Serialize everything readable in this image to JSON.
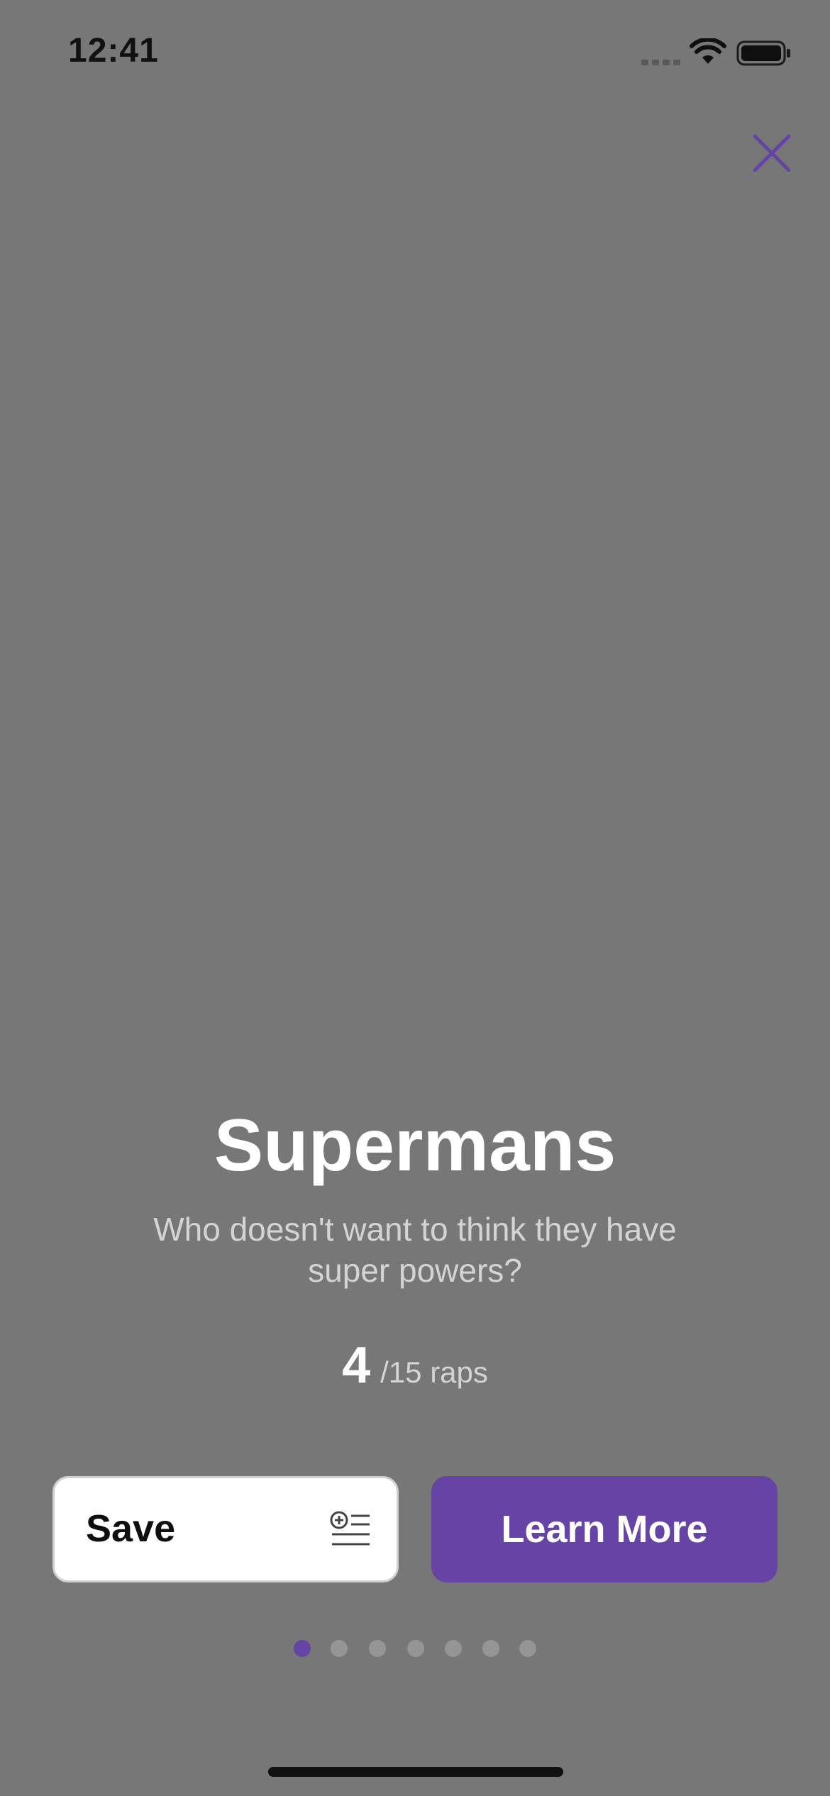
{
  "status_bar": {
    "time": "12:41"
  },
  "card": {
    "title": "Supermans",
    "subtitle": "Who doesn't want to think they have super powers?",
    "count": "4",
    "count_suffix": "/15 raps"
  },
  "actions": {
    "save_label": "Save",
    "learn_more_label": "Learn More"
  },
  "pagination": {
    "total": 7,
    "active_index": 0
  },
  "colors": {
    "background": "#777777",
    "accent": "#6544a6",
    "page_dot_inactive": "#959595"
  },
  "icons": {
    "close": "close-icon",
    "save": "list-add-icon",
    "status": [
      "cellular-signal-icon",
      "wifi-icon",
      "battery-icon"
    ]
  }
}
